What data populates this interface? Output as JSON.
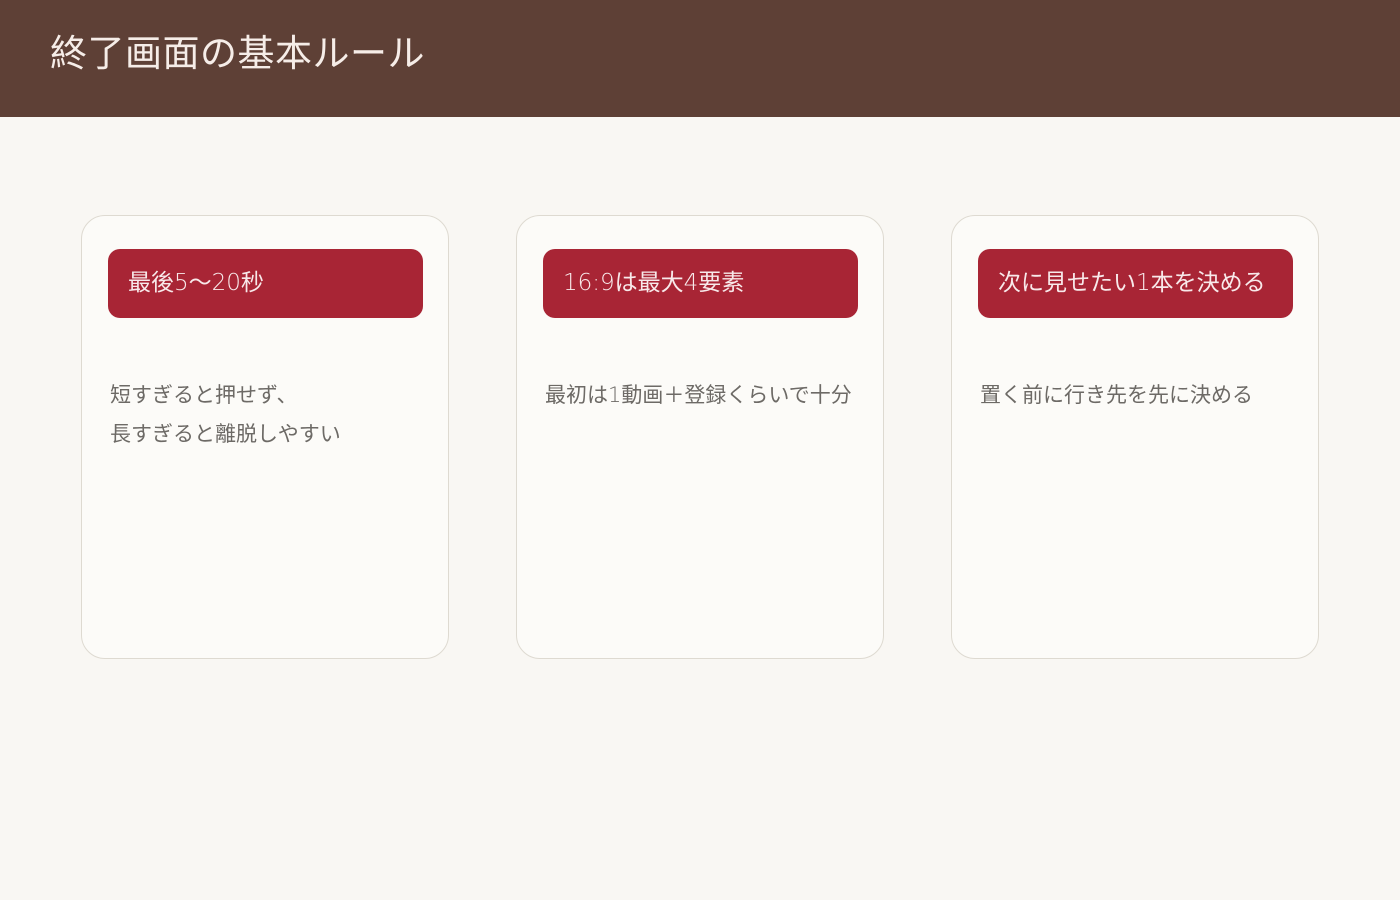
{
  "header": {
    "title": "終了画面の基本ルール"
  },
  "cards": [
    {
      "tag": "最後5〜20秒",
      "body": [
        "短すぎると押せず、",
        "長すぎると離脱しやすい"
      ]
    },
    {
      "tag": "16:9は最大4要素",
      "body": [
        "最初は1動画＋登録くらいで十分"
      ]
    },
    {
      "tag": "次に見せたい1本を決める",
      "body": [
        "置く前に行き先を先に決める"
      ]
    }
  ],
  "colors": {
    "header_bg": "#5e4036",
    "tag_bg": "#a82535",
    "page_bg": "#f9f7f3",
    "card_bg": "#fcfbf8"
  }
}
